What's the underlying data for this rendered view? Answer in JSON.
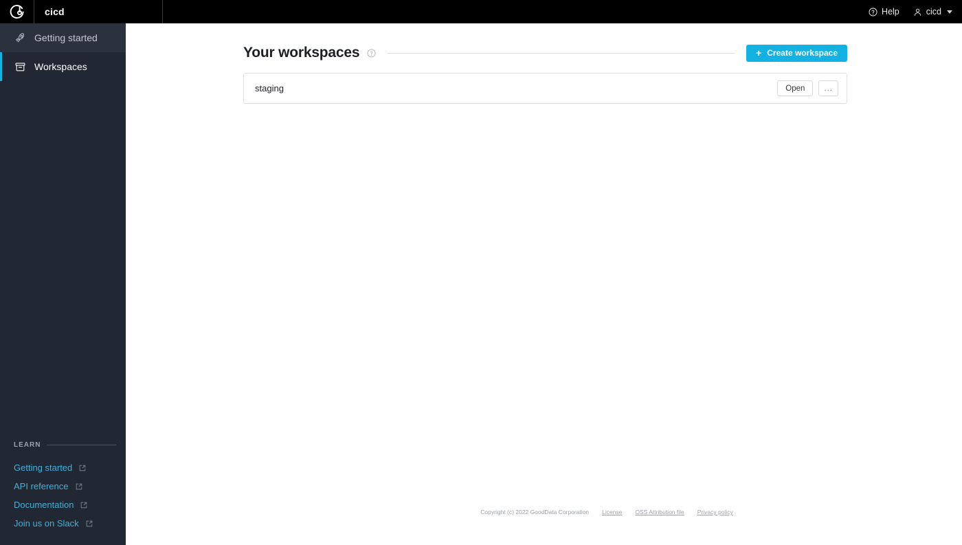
{
  "topbar": {
    "logo_icon": "gooddata-logo-icon",
    "project_title": "cicd",
    "help_label": "Help",
    "help_icon": "question-circle-icon",
    "user_label": "cicd",
    "user_icon": "user-icon",
    "chevron_icon": "chevron-down-icon"
  },
  "sidebar": {
    "items": [
      {
        "label": "Getting started",
        "icon": "rocket-icon",
        "active": false
      },
      {
        "label": "Workspaces",
        "icon": "archive-box-icon",
        "active": true
      }
    ],
    "learn": {
      "heading": "LEARN",
      "links": [
        {
          "label": "Getting started",
          "icon": "external-link-icon"
        },
        {
          "label": "API reference",
          "icon": "external-link-icon"
        },
        {
          "label": "Documentation",
          "icon": "external-link-icon"
        },
        {
          "label": "Join us on Slack",
          "icon": "external-link-icon"
        }
      ]
    }
  },
  "main": {
    "page_title": "Your workspaces",
    "title_help_icon": "question-circle-icon",
    "create_button": {
      "label": "Create workspace",
      "icon": "plus-icon"
    },
    "workspaces": [
      {
        "name": "staging",
        "open_label": "Open",
        "more_label": "..."
      }
    ]
  },
  "footer": {
    "copyright": "Copyright (c) 2022 GoodData Corporation",
    "links": [
      {
        "label": "License"
      },
      {
        "label": "OSS Attribution file"
      },
      {
        "label": "Privacy policy"
      }
    ]
  },
  "colors": {
    "accent": "#14b2e2",
    "topbar_bg": "#000000",
    "sidebar_bg": "#222833",
    "sidebar_link": "#41b0da"
  }
}
